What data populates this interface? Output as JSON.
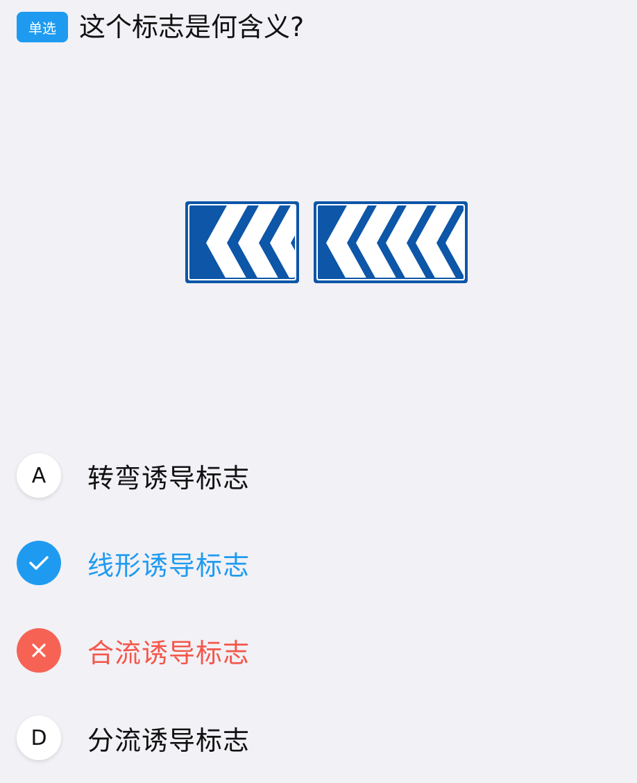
{
  "question": {
    "type_badge": "单选",
    "title": "这个标志是何含义?"
  },
  "sign_image": {
    "colors": {
      "blue": "#0d56a8",
      "white": "#ffffff"
    }
  },
  "options": [
    {
      "marker": "A",
      "text": "转弯诱导标志",
      "state": "normal"
    },
    {
      "marker": "check-icon",
      "text": "线形诱导标志",
      "state": "correct"
    },
    {
      "marker": "close-icon",
      "text": "合流诱导标志",
      "state": "wrong"
    },
    {
      "marker": "D",
      "text": "分流诱导标志",
      "state": "normal"
    }
  ],
  "colors": {
    "accent": "#1e9bf0",
    "correct": "#1e9bf0",
    "wrong": "#f4574a",
    "background": "#f2f1f6"
  }
}
